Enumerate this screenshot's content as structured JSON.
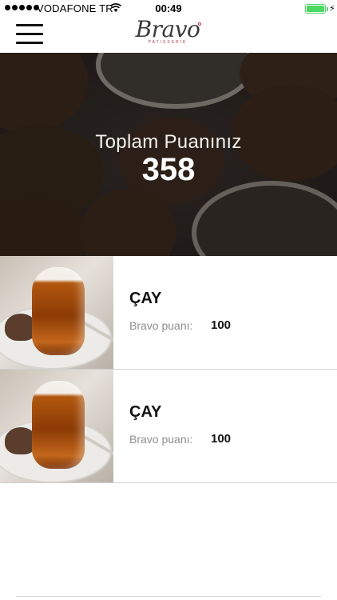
{
  "status_bar": {
    "carrier": "VODAFONE TR",
    "time": "00:49",
    "battery_level": 1.0
  },
  "header": {
    "logo_text": "Bravo",
    "logo_subtext": "PATISSERIE"
  },
  "hero": {
    "title": "Toplam Puanınız",
    "score": "358"
  },
  "items": [
    {
      "title": "ÇAY",
      "points_label": "Bravo puanı:",
      "points": "100"
    },
    {
      "title": "ÇAY",
      "points_label": "Bravo puanı:",
      "points": "100"
    }
  ],
  "colors": {
    "battery": "#4cd964",
    "logo_accent": "#b03a48"
  }
}
